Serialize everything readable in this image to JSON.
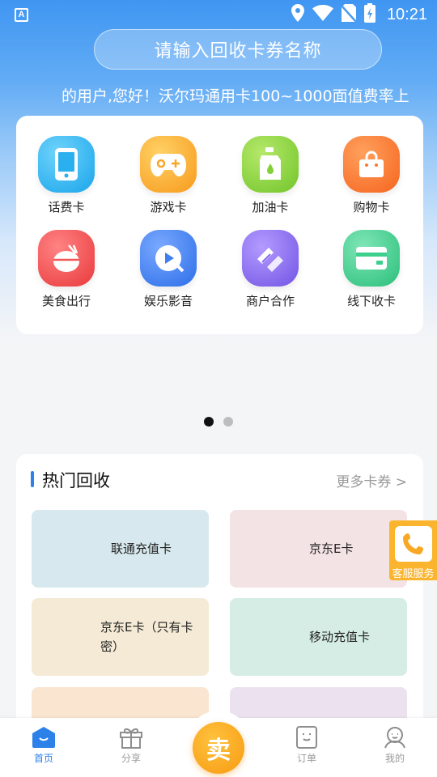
{
  "status_bar": {
    "time": "10:21",
    "app_badge": "A"
  },
  "search": {
    "placeholder": "请输入回收卡券名称"
  },
  "marquee": {
    "text": "的用户,您好！沃尔玛通用卡100~1000面值费率上"
  },
  "categories": [
    {
      "label": "话费卡",
      "icon": "phone-icon",
      "color": "#2db6f2"
    },
    {
      "label": "游戏卡",
      "icon": "gamepad-icon",
      "color": "#fba52b"
    },
    {
      "label": "加油卡",
      "icon": "fuel-can-icon",
      "color": "#8bd23a"
    },
    {
      "label": "购物卡",
      "icon": "shopping-bag-icon",
      "color": "#fb7a34"
    },
    {
      "label": "美食出行",
      "icon": "food-bowl-icon",
      "color": "#f25557"
    },
    {
      "label": "娱乐影音",
      "icon": "play-video-icon",
      "color": "#3f7ff0"
    },
    {
      "label": "商户合作",
      "icon": "handshake-icon",
      "color": "#8a6cf0"
    },
    {
      "label": "线下收卡",
      "icon": "card-icon",
      "color": "#3cd08c"
    }
  ],
  "pager": {
    "count": 2,
    "active": 0
  },
  "hot": {
    "title": "热门回收",
    "more": "更多卡券 >",
    "tiles": [
      {
        "label": "联通充值卡",
        "color": "#d7e9ee"
      },
      {
        "label": "京东E卡",
        "color": "#f4e3e5"
      },
      {
        "label": "京东E卡（只有卡密）",
        "color": "#f4ead5"
      },
      {
        "label": "移动充值卡",
        "color": "#d5ede4"
      },
      {
        "label": "",
        "color": "#fae5d1"
      },
      {
        "label": "",
        "color": "#ece2ef"
      }
    ]
  },
  "float_service": {
    "label": "客服服务",
    "icon": "telephone-icon",
    "color": "#fbb42d"
  },
  "nav": {
    "items": [
      {
        "label": "首页",
        "icon": "home-icon",
        "active": true
      },
      {
        "label": "分享",
        "icon": "gift-icon",
        "active": false
      },
      {
        "label": "订单",
        "icon": "order-icon",
        "active": false
      },
      {
        "label": "我的",
        "icon": "profile-icon",
        "active": false
      }
    ],
    "sell_label": "卖"
  },
  "colors": {
    "accent": "#2c82e8",
    "sell": "#f9a825"
  }
}
